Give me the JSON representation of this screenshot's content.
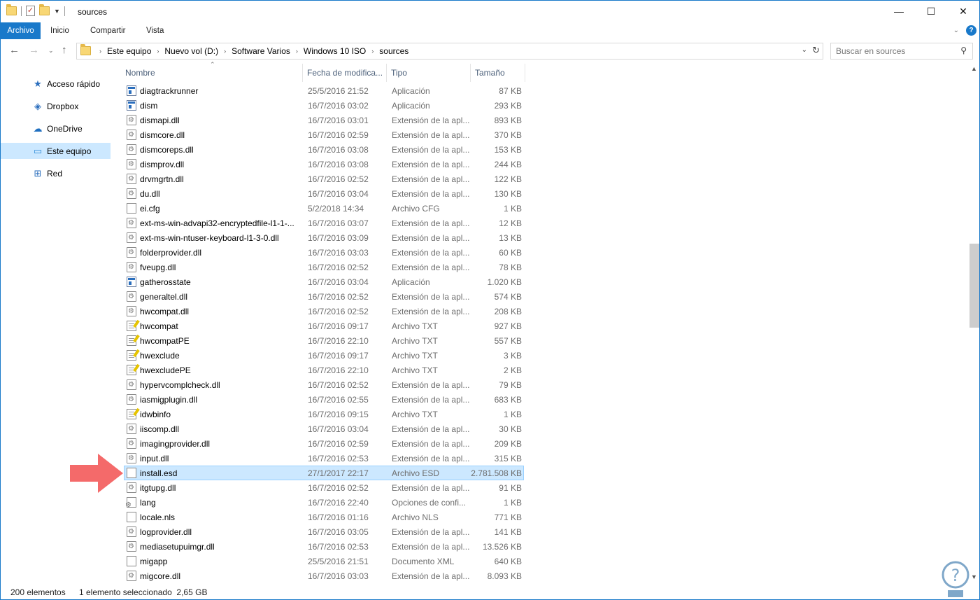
{
  "window": {
    "title": "sources"
  },
  "window_controls": {
    "minimize": "—",
    "maximize": "☐",
    "close": "✕"
  },
  "ribbon": {
    "tabs": [
      "Archivo",
      "Inicio",
      "Compartir",
      "Vista"
    ],
    "help": "?"
  },
  "address": {
    "breadcrumbs": [
      "Este equipo",
      "Nuevo vol (D:)",
      "Software Varios",
      "Windows 10 ISO",
      "sources"
    ]
  },
  "search": {
    "placeholder": "Buscar en sources"
  },
  "nav_pane": {
    "items": [
      {
        "label": "Acceso rápido",
        "icon": "star-icon"
      },
      {
        "label": "Dropbox",
        "icon": "dropbox-icon"
      },
      {
        "label": "OneDrive",
        "icon": "cloud-icon"
      },
      {
        "label": "Este equipo",
        "icon": "computer-icon",
        "selected": true
      },
      {
        "label": "Red",
        "icon": "network-icon"
      }
    ]
  },
  "columns": {
    "name": "Nombre",
    "date": "Fecha de modifica...",
    "type": "Tipo",
    "size": "Tamaño"
  },
  "files": [
    {
      "name": "diagtrackrunner",
      "date": "25/5/2016 21:52",
      "type": "Aplicación",
      "size": "87 KB",
      "icon": "app"
    },
    {
      "name": "dism",
      "date": "16/7/2016 03:02",
      "type": "Aplicación",
      "size": "293 KB",
      "icon": "app"
    },
    {
      "name": "dismapi.dll",
      "date": "16/7/2016 03:01",
      "type": "Extensión de la apl...",
      "size": "893 KB",
      "icon": "dll"
    },
    {
      "name": "dismcore.dll",
      "date": "16/7/2016 02:59",
      "type": "Extensión de la apl...",
      "size": "370 KB",
      "icon": "dll"
    },
    {
      "name": "dismcoreps.dll",
      "date": "16/7/2016 03:08",
      "type": "Extensión de la apl...",
      "size": "153 KB",
      "icon": "dll"
    },
    {
      "name": "dismprov.dll",
      "date": "16/7/2016 03:08",
      "type": "Extensión de la apl...",
      "size": "244 KB",
      "icon": "dll"
    },
    {
      "name": "drvmgrtn.dll",
      "date": "16/7/2016 02:52",
      "type": "Extensión de la apl...",
      "size": "122 KB",
      "icon": "dll"
    },
    {
      "name": "du.dll",
      "date": "16/7/2016 03:04",
      "type": "Extensión de la apl...",
      "size": "130 KB",
      "icon": "dll"
    },
    {
      "name": "ei.cfg",
      "date": "5/2/2018 14:34",
      "type": "Archivo CFG",
      "size": "1 KB",
      "icon": "file"
    },
    {
      "name": "ext-ms-win-advapi32-encryptedfile-l1-1-...",
      "date": "16/7/2016 03:07",
      "type": "Extensión de la apl...",
      "size": "12 KB",
      "icon": "dll"
    },
    {
      "name": "ext-ms-win-ntuser-keyboard-l1-3-0.dll",
      "date": "16/7/2016 03:09",
      "type": "Extensión de la apl...",
      "size": "13 KB",
      "icon": "dll"
    },
    {
      "name": "folderprovider.dll",
      "date": "16/7/2016 03:03",
      "type": "Extensión de la apl...",
      "size": "60 KB",
      "icon": "dll"
    },
    {
      "name": "fveupg.dll",
      "date": "16/7/2016 02:52",
      "type": "Extensión de la apl...",
      "size": "78 KB",
      "icon": "dll"
    },
    {
      "name": "gatherosstate",
      "date": "16/7/2016 03:04",
      "type": "Aplicación",
      "size": "1.020 KB",
      "icon": "app"
    },
    {
      "name": "generaltel.dll",
      "date": "16/7/2016 02:52",
      "type": "Extensión de la apl...",
      "size": "574 KB",
      "icon": "dll"
    },
    {
      "name": "hwcompat.dll",
      "date": "16/7/2016 02:52",
      "type": "Extensión de la apl...",
      "size": "208 KB",
      "icon": "dll"
    },
    {
      "name": "hwcompat",
      "date": "16/7/2016 09:17",
      "type": "Archivo TXT",
      "size": "927 KB",
      "icon": "txt"
    },
    {
      "name": "hwcompatPE",
      "date": "16/7/2016 22:10",
      "type": "Archivo TXT",
      "size": "557 KB",
      "icon": "txt"
    },
    {
      "name": "hwexclude",
      "date": "16/7/2016 09:17",
      "type": "Archivo TXT",
      "size": "3 KB",
      "icon": "txt"
    },
    {
      "name": "hwexcludePE",
      "date": "16/7/2016 22:10",
      "type": "Archivo TXT",
      "size": "2 KB",
      "icon": "txt"
    },
    {
      "name": "hypervcomplcheck.dll",
      "date": "16/7/2016 02:52",
      "type": "Extensión de la apl...",
      "size": "79 KB",
      "icon": "dll"
    },
    {
      "name": "iasmigplugin.dll",
      "date": "16/7/2016 02:55",
      "type": "Extensión de la apl...",
      "size": "683 KB",
      "icon": "dll"
    },
    {
      "name": "idwbinfo",
      "date": "16/7/2016 09:15",
      "type": "Archivo TXT",
      "size": "1 KB",
      "icon": "txt"
    },
    {
      "name": "iiscomp.dll",
      "date": "16/7/2016 03:04",
      "type": "Extensión de la apl...",
      "size": "30 KB",
      "icon": "dll"
    },
    {
      "name": "imagingprovider.dll",
      "date": "16/7/2016 02:59",
      "type": "Extensión de la apl...",
      "size": "209 KB",
      "icon": "dll"
    },
    {
      "name": "input.dll",
      "date": "16/7/2016 02:53",
      "type": "Extensión de la apl...",
      "size": "315 KB",
      "icon": "dll"
    },
    {
      "name": "install.esd",
      "date": "27/1/2017 22:17",
      "type": "Archivo ESD",
      "size": "2.781.508 KB",
      "icon": "file",
      "selected": true
    },
    {
      "name": "itgtupg.dll",
      "date": "16/7/2016 02:52",
      "type": "Extensión de la apl...",
      "size": "91 KB",
      "icon": "dll"
    },
    {
      "name": "lang",
      "date": "16/7/2016 22:40",
      "type": "Opciones de confi...",
      "size": "1 KB",
      "icon": "cfg"
    },
    {
      "name": "locale.nls",
      "date": "16/7/2016 01:16",
      "type": "Archivo NLS",
      "size": "771 KB",
      "icon": "file"
    },
    {
      "name": "logprovider.dll",
      "date": "16/7/2016 03:05",
      "type": "Extensión de la apl...",
      "size": "141 KB",
      "icon": "dll"
    },
    {
      "name": "mediasetupuimgr.dll",
      "date": "16/7/2016 02:53",
      "type": "Extensión de la apl...",
      "size": "13.526 KB",
      "icon": "dll"
    },
    {
      "name": "migapp",
      "date": "25/5/2016 21:51",
      "type": "Documento XML",
      "size": "640 KB",
      "icon": "xml"
    },
    {
      "name": "migcore.dll",
      "date": "16/7/2016 03:03",
      "type": "Extensión de la apl...",
      "size": "8.093 KB",
      "icon": "dll"
    }
  ],
  "status": {
    "count": "200 elementos",
    "selection": "1 elemento seleccionado  2,65 GB"
  },
  "colors": {
    "accent": "#1979ca",
    "selection": "#cce8ff",
    "arrow": "#f46a6a"
  }
}
